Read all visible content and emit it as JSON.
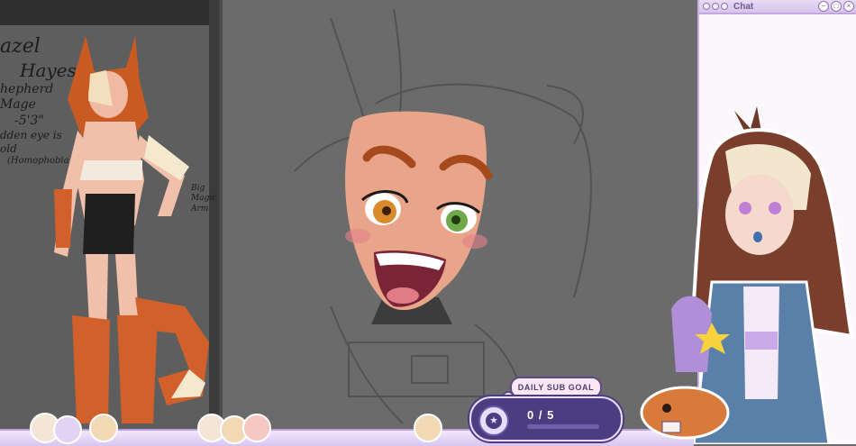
{
  "reference": {
    "notes": [
      "azel",
      "Hayes",
      "hepherd Mage",
      "-5'3\"",
      "dden eye is",
      "old",
      "(Homophobia)"
    ],
    "side_notes": [
      "Big",
      "Magic",
      "Arm"
    ]
  },
  "chat": {
    "title": "Chat",
    "minimize": "−",
    "maximize": "□",
    "close": "×"
  },
  "sub_goal": {
    "label": "DAILY SUB GOAL",
    "count": "0 / 5",
    "current": 0,
    "target": 5
  },
  "colors": {
    "canvas_bg": "#6b6b6b",
    "chat_accent": "#c2a7e3",
    "goal_bg": "#4b3d7f",
    "skin": "#e8a58a",
    "hair_orange": "#c85a22"
  },
  "icons": [
    "star-icon",
    "window-dots-icon"
  ]
}
